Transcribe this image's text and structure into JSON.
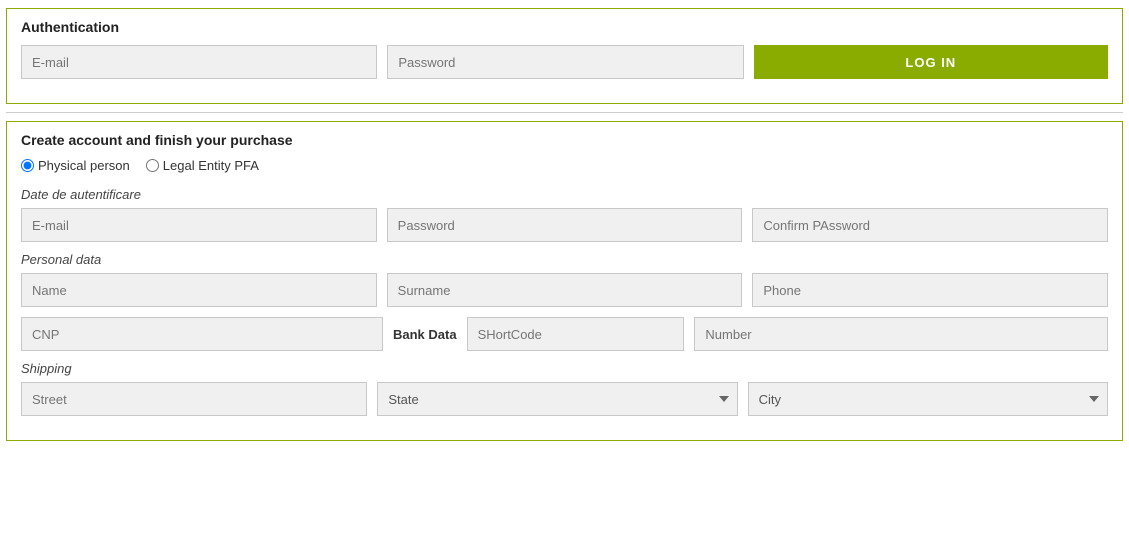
{
  "authentication": {
    "title": "Authentication",
    "email_placeholder": "E-mail",
    "password_placeholder": "Password",
    "login_button": "LOG IN"
  },
  "create_account": {
    "title": "Create account and finish your purchase",
    "radio_physical": "Physical person",
    "radio_legal": "Legal Entity PFA",
    "auth_section_label": "Date de autentificare",
    "email_placeholder": "E-mail",
    "password_placeholder": "Password",
    "confirm_password_placeholder": "Confirm PAssword",
    "personal_section_label": "Personal data",
    "name_placeholder": "Name",
    "surname_placeholder": "Surname",
    "phone_placeholder": "Phone",
    "cnp_placeholder": "CNP",
    "bank_data_label": "Bank Data",
    "shortcode_placeholder": "SHortCode",
    "number_placeholder": "Number",
    "shipping_section_label": "Shipping",
    "street_placeholder": "Street",
    "state_placeholder": "State",
    "city_placeholder": "City"
  }
}
